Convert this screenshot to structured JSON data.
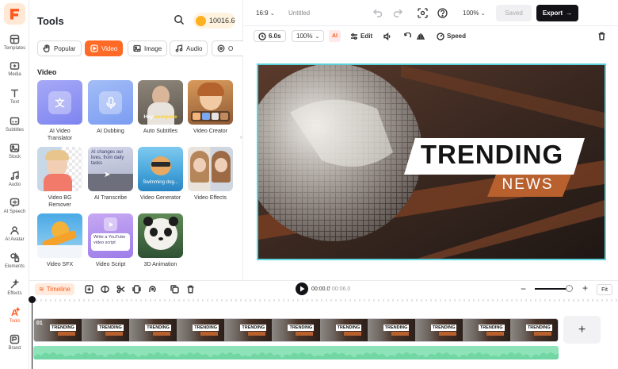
{
  "sidebar": {
    "items": [
      {
        "label": "Templates",
        "icon": "templates-icon"
      },
      {
        "label": "Media",
        "icon": "media-icon"
      },
      {
        "label": "Text",
        "icon": "text-icon"
      },
      {
        "label": "Subtitles",
        "icon": "subtitles-icon"
      },
      {
        "label": "Stock",
        "icon": "stock-icon"
      },
      {
        "label": "Audio",
        "icon": "audio-icon"
      },
      {
        "label": "AI Speech",
        "icon": "ai-speech-icon"
      },
      {
        "label": "AI Avatar",
        "icon": "ai-avatar-icon"
      },
      {
        "label": "Elements",
        "icon": "elements-icon"
      },
      {
        "label": "Effects",
        "icon": "effects-icon"
      },
      {
        "label": "Tools",
        "icon": "tools-icon",
        "active": true
      },
      {
        "label": "Brand",
        "icon": "brand-icon"
      }
    ]
  },
  "panel": {
    "title": "Tools",
    "credits": "10016.6",
    "tabs": [
      "Popular",
      "Video",
      "Image",
      "Audio",
      "O"
    ],
    "active_tab": "Video",
    "section": "Video",
    "cards": [
      {
        "label": "AI Video Translator"
      },
      {
        "label": "AI Dubbing"
      },
      {
        "label": "Auto Subtitles",
        "overlay_a": "Hey ",
        "overlay_b": "everyone"
      },
      {
        "label": "Video Creator"
      },
      {
        "label": "Video BG Remover"
      },
      {
        "label": "AI Transcribe",
        "overlay": "AI changes our lives, from daily tasks"
      },
      {
        "label": "Video Generator",
        "overlay": "Swimming dog..."
      },
      {
        "label": "Video Effects"
      },
      {
        "label": "Video SFX"
      },
      {
        "label": "Video Script",
        "overlay": "Write a YouTube video script"
      },
      {
        "label": "3D Animation"
      }
    ]
  },
  "topbar": {
    "ratio": "16:9",
    "title": "Untitled",
    "zoom": "100%",
    "saved": "Saved",
    "export": "Export"
  },
  "toolbar": {
    "duration": "6.0s",
    "scale": "100%",
    "ai": "AI",
    "edit": "Edit",
    "speed": "Speed"
  },
  "preview": {
    "headline_1": "TRENDING",
    "headline_2": "NEWS"
  },
  "timeline": {
    "label": "Timeline",
    "current_time": "00:00.0",
    "total_time": "/ 00:06.0",
    "fit": "Fit",
    "clip_number": "01",
    "clip_frame_text": "TRENDING"
  },
  "colors": {
    "accent": "#ff6a26",
    "export_bg": "#121217",
    "preview_border": "#5bd3dd",
    "audio_track": "#8ee3b8"
  }
}
